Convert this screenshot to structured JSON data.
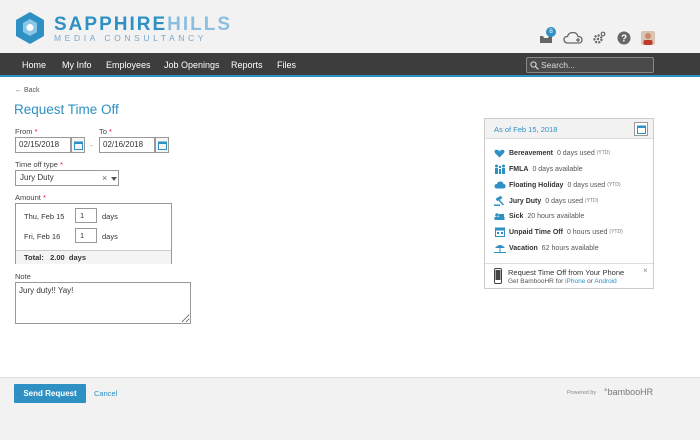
{
  "header": {
    "brand_bold": "SAPPHIRE",
    "brand_light": "HILLS",
    "tagline": "MEDIA CONSULTANCY",
    "inbox_badge": "8",
    "colors": {
      "accent": "#2e90c3",
      "nav_bg": "#3d3d3d"
    }
  },
  "nav": {
    "items": [
      "Home",
      "My Info",
      "Employees",
      "Job Openings",
      "Reports",
      "Files"
    ],
    "search_placeholder": "Search..."
  },
  "form": {
    "back_label": "← Back",
    "title": "Request Time Off",
    "from_label": "From",
    "to_label": "To",
    "required_mark": "*",
    "from_value": "02/15/2018",
    "range_separator": "-",
    "to_value": "02/16/2018",
    "type_label": "Time off type",
    "type_value": "Jury Duty",
    "amount_label": "Amount",
    "rows": [
      {
        "day": "Thu, Feb 15",
        "value": "1",
        "unit": "days"
      },
      {
        "day": "Fri, Feb 16",
        "value": "1",
        "unit": "days"
      }
    ],
    "total_label": "Total:",
    "total_value": "2.00  days",
    "note_label": "Note",
    "note_value": "Jury duty!! Yay!"
  },
  "panel": {
    "heading": "As of Feb 15, 2018",
    "balances": [
      {
        "name": "Bereavement",
        "text": "0 days used",
        "ytd": "(YTD)",
        "icon": "heart-icon"
      },
      {
        "name": "FMLA",
        "text": "0 days available",
        "ytd": "",
        "icon": "family-icon"
      },
      {
        "name": "Floating Holiday",
        "text": "0 days used",
        "ytd": "(YTD)",
        "icon": "cloud-icon"
      },
      {
        "name": "Jury Duty",
        "text": "0 days used",
        "ytd": "(YTD)",
        "icon": "gavel-icon"
      },
      {
        "name": "Sick",
        "text": "20 hours available",
        "ytd": "",
        "icon": "sick-icon"
      },
      {
        "name": "Unpaid Time Off",
        "text": "0 hours used",
        "ytd": "(YTD)",
        "icon": "calendar-icon"
      },
      {
        "name": "Vacation",
        "text": "62 hours available",
        "ytd": "",
        "icon": "beach-icon"
      }
    ],
    "mobile_title": "Request Time Off from Your Phone",
    "mobile_prefix": "Get BambooHR for",
    "mobile_iphone": "iPhone",
    "mobile_or": "or",
    "mobile_android": "Android",
    "close_label": "×"
  },
  "footer": {
    "send_label": "Send Request",
    "cancel_label": "Cancel",
    "powered_label": "Powered by",
    "bamboo_label": "°bambooHR"
  }
}
